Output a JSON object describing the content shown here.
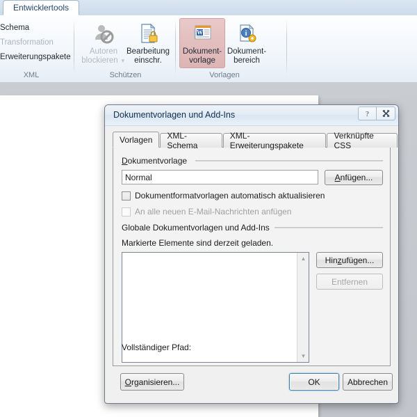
{
  "ribbon": {
    "active_tab": "Entwicklertools",
    "groups": [
      {
        "name": "XML",
        "label": "XML",
        "items": [
          {
            "label": "Schema",
            "disabled": false
          },
          {
            "label": "Transformation",
            "disabled": true
          },
          {
            "label": "Erweiterungspakete",
            "disabled": false
          }
        ]
      },
      {
        "name": "Schuetzen",
        "label": "Schützen",
        "buttons": [
          {
            "label_line1": "Autoren",
            "label_line2": "blockieren",
            "icon": "block-author-icon",
            "disabled": true,
            "has_dropdown": true
          },
          {
            "label_line1": "Bearbeitung",
            "label_line2": "einschr.",
            "icon": "restrict-editing-icon",
            "disabled": false,
            "has_dropdown": false
          }
        ]
      },
      {
        "name": "Vorlagen",
        "label": "Vorlagen",
        "buttons": [
          {
            "label_line1": "Dokument-",
            "label_line2": "vorlage",
            "icon": "document-template-icon",
            "disabled": false,
            "pressed": true
          },
          {
            "label_line1": "Dokument-",
            "label_line2": "bereich",
            "icon": "document-panel-icon",
            "disabled": false,
            "pressed": false
          }
        ]
      }
    ]
  },
  "dialog": {
    "title": "Dokumentvorlagen und Add-Ins",
    "help_button": "?",
    "close_button": "✕",
    "tabs": [
      {
        "label": "Vorlagen",
        "active": true
      },
      {
        "label": "XML-Schema",
        "active": false
      },
      {
        "label": "XML-Erweiterungspakete",
        "active": false
      },
      {
        "label": "Verknüpfte CSS",
        "active": false
      }
    ],
    "template_group": {
      "title": "Dokumentvorlage",
      "field_value": "Normal",
      "attach_button": "Anfügen...",
      "checkbox_auto_update": "Dokumentformatvorlagen automatisch aktualisieren",
      "checkbox_auto_update_checked": false,
      "checkbox_attach_mail": "An alle neuen E-Mail-Nachrichten anfügen",
      "checkbox_attach_mail_checked": false,
      "checkbox_attach_mail_disabled": true
    },
    "global_group": {
      "title": "Globale Dokumentvorlagen und Add-Ins",
      "hint": "Markierte Elemente sind derzeit geladen.",
      "list_items": [],
      "add_button": "Hinzufügen...",
      "remove_button": "Entfernen",
      "remove_button_disabled": true
    },
    "full_path_label": "Vollständiger Pfad:",
    "full_path_value": "",
    "footer": {
      "organize_button": "Organisieren...",
      "ok_button": "OK",
      "cancel_button": "Abbrechen"
    }
  }
}
